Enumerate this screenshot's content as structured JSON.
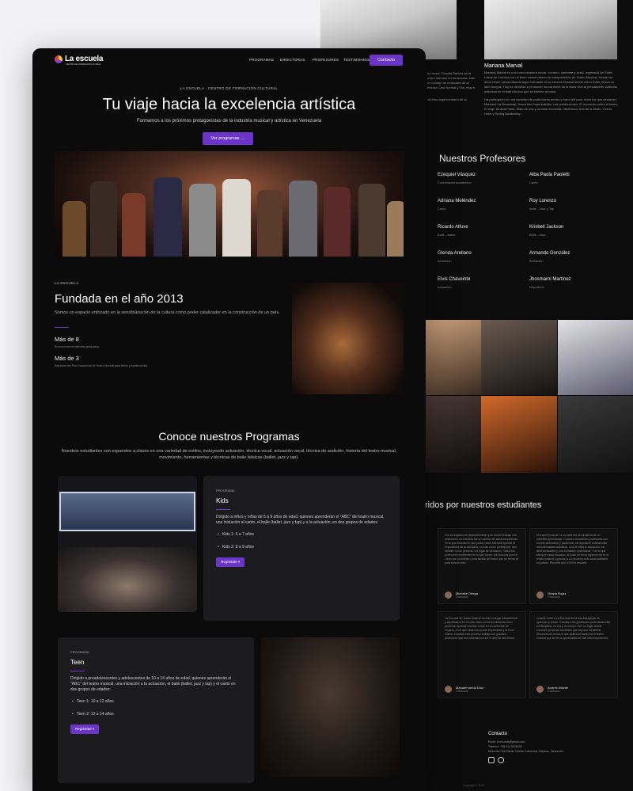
{
  "nav": {
    "brand": "La escuela",
    "brand_sub": "CENTRO DE FORMACIÓN CULTURAL",
    "items": [
      "PROGRAMAS",
      "DIRECTORAS",
      "PROFESORES",
      "TESTIMONIOS"
    ],
    "contact": "Contacto"
  },
  "hero": {
    "eyebrow": "LA ESCUELA · CENTRO DE FORMACIÓN CULTURAL",
    "title": "Tu viaje hacia la excelencia artística",
    "subtitle": "Formamos a los próximos protagonistas de la industria musical y artística en Venezuela",
    "cta": "Ver programas →"
  },
  "founded": {
    "eyebrow": "LA ESCUELA",
    "title": "Fundada en el año 2013",
    "text": "Somos un espacio enfocado en la sensibilización de la cultura como poder catalizador en la construcción de un país.",
    "stats": [
      {
        "value": "Más de 8",
        "desc": "Promociones de talentos graduados"
      },
      {
        "value": "Más de 3",
        "desc": "Ediciones del Plan Vacacional de Teatro Musical para Niños y Adolescentes"
      }
    ]
  },
  "programs": {
    "title": "Conoce nuestros Programas",
    "subtitle": "Nuestros estudiantes son expuestos a clases en una variedad de estilos, incluyendo actuación, técnica vocal, actuación vocal, técnica de audición, historia del teatro musical, movimiento, herramientas y técnicas de baile básicas (ballet, jazz y tap).",
    "cards": [
      {
        "eyebrow": "PROGRAMA",
        "title": "Kids",
        "desc": "Dirigido a niños y niñas de 5 a 9 años de edad, quienes aprenderán el \"ABC\" del teatro musical, una iniciación al canto, el baile (ballet, jazz y tap) y a la actuación, en dos grupos de edades:",
        "items": [
          "Kids 1: 5 a 7 años",
          "Kids 2: 8 a 9 años"
        ],
        "cta": "Registrate ▾"
      },
      {
        "eyebrow": "PROGRAMA",
        "title": "Teen",
        "desc": "Dirigido a preadolescentes y adolescentes de 10 a 14 años de edad, quienes aprenderán el \"ABC\" del teatro musical, una iniciación a la actuación, el baile (ballet, jazz y tap) y el canto en dos grupos de edades:",
        "items": [
          "Teen 1: 10 a 12 años",
          "Teen 2: 13 a 14 años"
        ],
        "cta": "Registrate ▾"
      }
    ]
  },
  "bio": {
    "name": "Mariana Marval",
    "text_left": "ba Israel, Claudia Sáchez es la mejor talentos en Venezuela. sido el montaje de musicales de la edidad. Casi Normal y Flor. Hoy a",
    "text_left2": "ctividad legal contrario de la",
    "text_right": "Mariana Marval es una comunicadora social, locutora, cantante y actriz, egresada del Taller Lakue de Londres con el título conservatorio en Interpretación de Teatro Musical. Desde los años vienen desarrollando lugar relevante en la escena Musical desde como Evita, Ahora un lado Amigos. Hoy es decidida a promover los cantores de la fama vital al prestadores. Además, actividad en el teatro busca que se sientan a todos.",
    "text_right2": "Ha participado en una variedad de particulares dentro y fuera del país, entre los que destacan: Mamma! La Broadway, Jesucristo Superestrella, Las producciones. El momento sobre el teatro, El Viaje de Ana Frank, Malo de una y la vista renovada, Oklahoma, Ana de la Mudo, Grand Hotel y Spring Awakening."
  },
  "teachers": {
    "title": "Nuestros Profesores",
    "list": [
      {
        "name": "Ezequiel Vásquez",
        "role": "Coordinador académico"
      },
      {
        "name": "Alba Paola Paoletti",
        "role": "Canto"
      },
      {
        "name": "Adriana Meléndez",
        "role": "Canto"
      },
      {
        "name": "Roy Lorenzo",
        "role": "Baile - Jazz y Tap"
      },
      {
        "name": "Ricardo Alfuve",
        "role": "Baile - Ballet"
      },
      {
        "name": "Krisbell Jackson",
        "role": "Baile - Jazz"
      },
      {
        "name": "Glenda Arellano",
        "role": "Actuación"
      },
      {
        "name": "Armando González",
        "role": "Actuación"
      },
      {
        "name": "Elvis Chaveinte",
        "role": "Actuación"
      },
      {
        "name": "Jhosmarni Martínez",
        "role": "Repertorio"
      }
    ]
  },
  "testimonials": {
    "title": "ridos por nuestros estudiantes",
    "items": [
      {
        "text": "Fue un espacio de descubrimiento y de mucho trabajo con profesores. La Escuela fue un camino de autoconocimiento en la que descubrí lo que podía crear. Además aprendí la importancia de la disciplina, no solo como profesional, sino también como persona. Un lugar de formación, Todos los profesores excelentes en lo que hacen: los vínculos que se crean son increíbles y esa familia del teatro que se forma es para toda la vida.",
        "name": "Michelle Ortega",
        "role": "Graduada"
      },
      {
        "text": "Mi experiencia de La escuela fue sin dudas la de un increíble aprendizaje. Conocí a excelentes profesores con mucha dedicación y paciencia, me ayudaron a desarrollar mis habilidades artísticas, una de ellas la actuación, me llevé amistades y una formación profesional. Y es lo que siempre había buscado. Al inicio no tenía experiencia en el teatro musical y gracias a La escuela pude sacar adelante mi pasión. Recomiendo 100% la escuela.",
        "name": "Oriana Rojas",
        "role": "Graduada"
      },
      {
        "text": "La Escuela de Teatro Musical ha sido un lugar fundamental y significativo en mi vida, tanto a nivel profesional como personal. Aprendí muchas cosas en un ambiente de respeto, en el que cada uno puede expresarse y ser uno mismo. Durante este proceso trabajé con grandes profesores que me enseñaron a ver el arte de otra forma.",
        "name": "Mariafernanda Díaz",
        "role": "Graduada"
      },
      {
        "text": "Cuando entré a La Escuela tenía muchas ganas de aprender y crecer. Gracias a los profesores pude desarrollar mi disciplina, mi voz y mi cuerpo. Fue un lugar donde encontré personas increíbles que hoy son mi familia. Recomiendo a todo el que quiera formarse en el teatro musical que se dé la oportunidad de vivir esta experiencia.",
        "name": "Andrés Infante",
        "role": "Graduado"
      }
    ]
  },
  "contact": {
    "title": "Contacto",
    "email": "Email: la.escuela@gmail.com",
    "phone": "Teléfono: +58 414-3326032",
    "address": "Dirección: 3ra Planta, Centro Comercial, Caracas, Venezuela"
  },
  "footer": {
    "copyright": "Copyright © 2023"
  },
  "colors": {
    "accent": "#6c35c9",
    "background": "#0b0b0b",
    "card": "#1c1c1e"
  }
}
